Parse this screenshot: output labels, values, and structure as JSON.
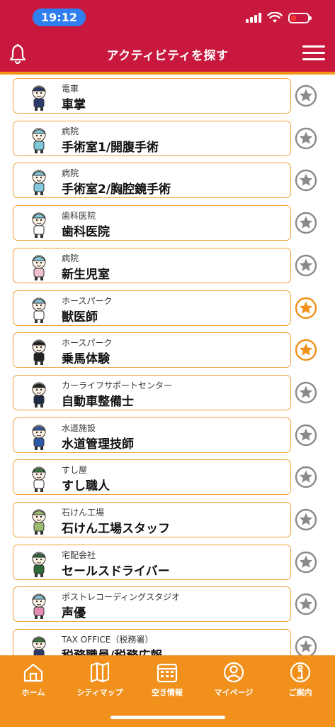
{
  "status_bar": {
    "time": "19:12"
  },
  "header": {
    "title": "アクティビティを探す"
  },
  "activities": [
    {
      "category": "電車",
      "name": "車掌",
      "favorited": false,
      "shirt": "#2b3a6b",
      "hat": "#2b3a6b"
    },
    {
      "category": "病院",
      "name": "手術室1/開腹手術",
      "favorited": false,
      "shirt": "#7fc7d9",
      "hat": "#7fc7d9"
    },
    {
      "category": "病院",
      "name": "手術室2/胸腔鏡手術",
      "favorited": false,
      "shirt": "#7fc7d9",
      "hat": "#7fc7d9"
    },
    {
      "category": "歯科医院",
      "name": "歯科医院",
      "favorited": false,
      "shirt": "#ffffff",
      "hat": "#7fc7d9"
    },
    {
      "category": "病院",
      "name": "新生児室",
      "favorited": false,
      "shirt": "#f3c2d1",
      "hat": "#7fc7d9"
    },
    {
      "category": "ホースパーク",
      "name": "獣医師",
      "favorited": true,
      "shirt": "#ffffff",
      "hat": "#7fc7d9"
    },
    {
      "category": "ホースパーク",
      "name": "乗馬体験",
      "favorited": true,
      "shirt": "#222222",
      "hat": "#222222"
    },
    {
      "category": "カーライフサポートセンター",
      "name": "自動車整備士",
      "favorited": false,
      "shirt": "#1f2a44",
      "hat": "#222222"
    },
    {
      "category": "水道施設",
      "name": "水道管理技師",
      "favorited": false,
      "shirt": "#2d5aa8",
      "hat": "#2d5aa8"
    },
    {
      "category": "すし屋",
      "name": "すし職人",
      "favorited": false,
      "shirt": "#ffffff",
      "hat": "#3a7a3a"
    },
    {
      "category": "石けん工場",
      "name": "石けん工場スタッフ",
      "favorited": false,
      "shirt": "#9dbb6e",
      "hat": "#9dbb6e"
    },
    {
      "category": "宅配会社",
      "name": "セールスドライバー",
      "favorited": false,
      "shirt": "#2e6b3a",
      "hat": "#2e6b3a"
    },
    {
      "category": "ポストレコーディングスタジオ",
      "name": "声優",
      "favorited": false,
      "shirt": "#e38cb4",
      "hat": "#7fc7d9"
    },
    {
      "category": "TAX OFFICE（税務署）",
      "name": "税務職員/税務広報",
      "favorited": false,
      "shirt": "#2b3a6b",
      "hat": "#3a7a3a"
    }
  ],
  "tabs": [
    {
      "label": "ホーム",
      "icon": "home-icon"
    },
    {
      "label": "シティマップ",
      "icon": "map-icon"
    },
    {
      "label": "空き情報",
      "icon": "calendar-icon"
    },
    {
      "label": "マイページ",
      "icon": "person-icon"
    },
    {
      "label": "ご案内",
      "icon": "info-icon"
    }
  ],
  "colors": {
    "header": "#c8183e",
    "accent_orange": "#f1901b",
    "card_border": "#f0a23a",
    "star_inactive": "#8a8a8a",
    "star_active": "#f1901b"
  }
}
